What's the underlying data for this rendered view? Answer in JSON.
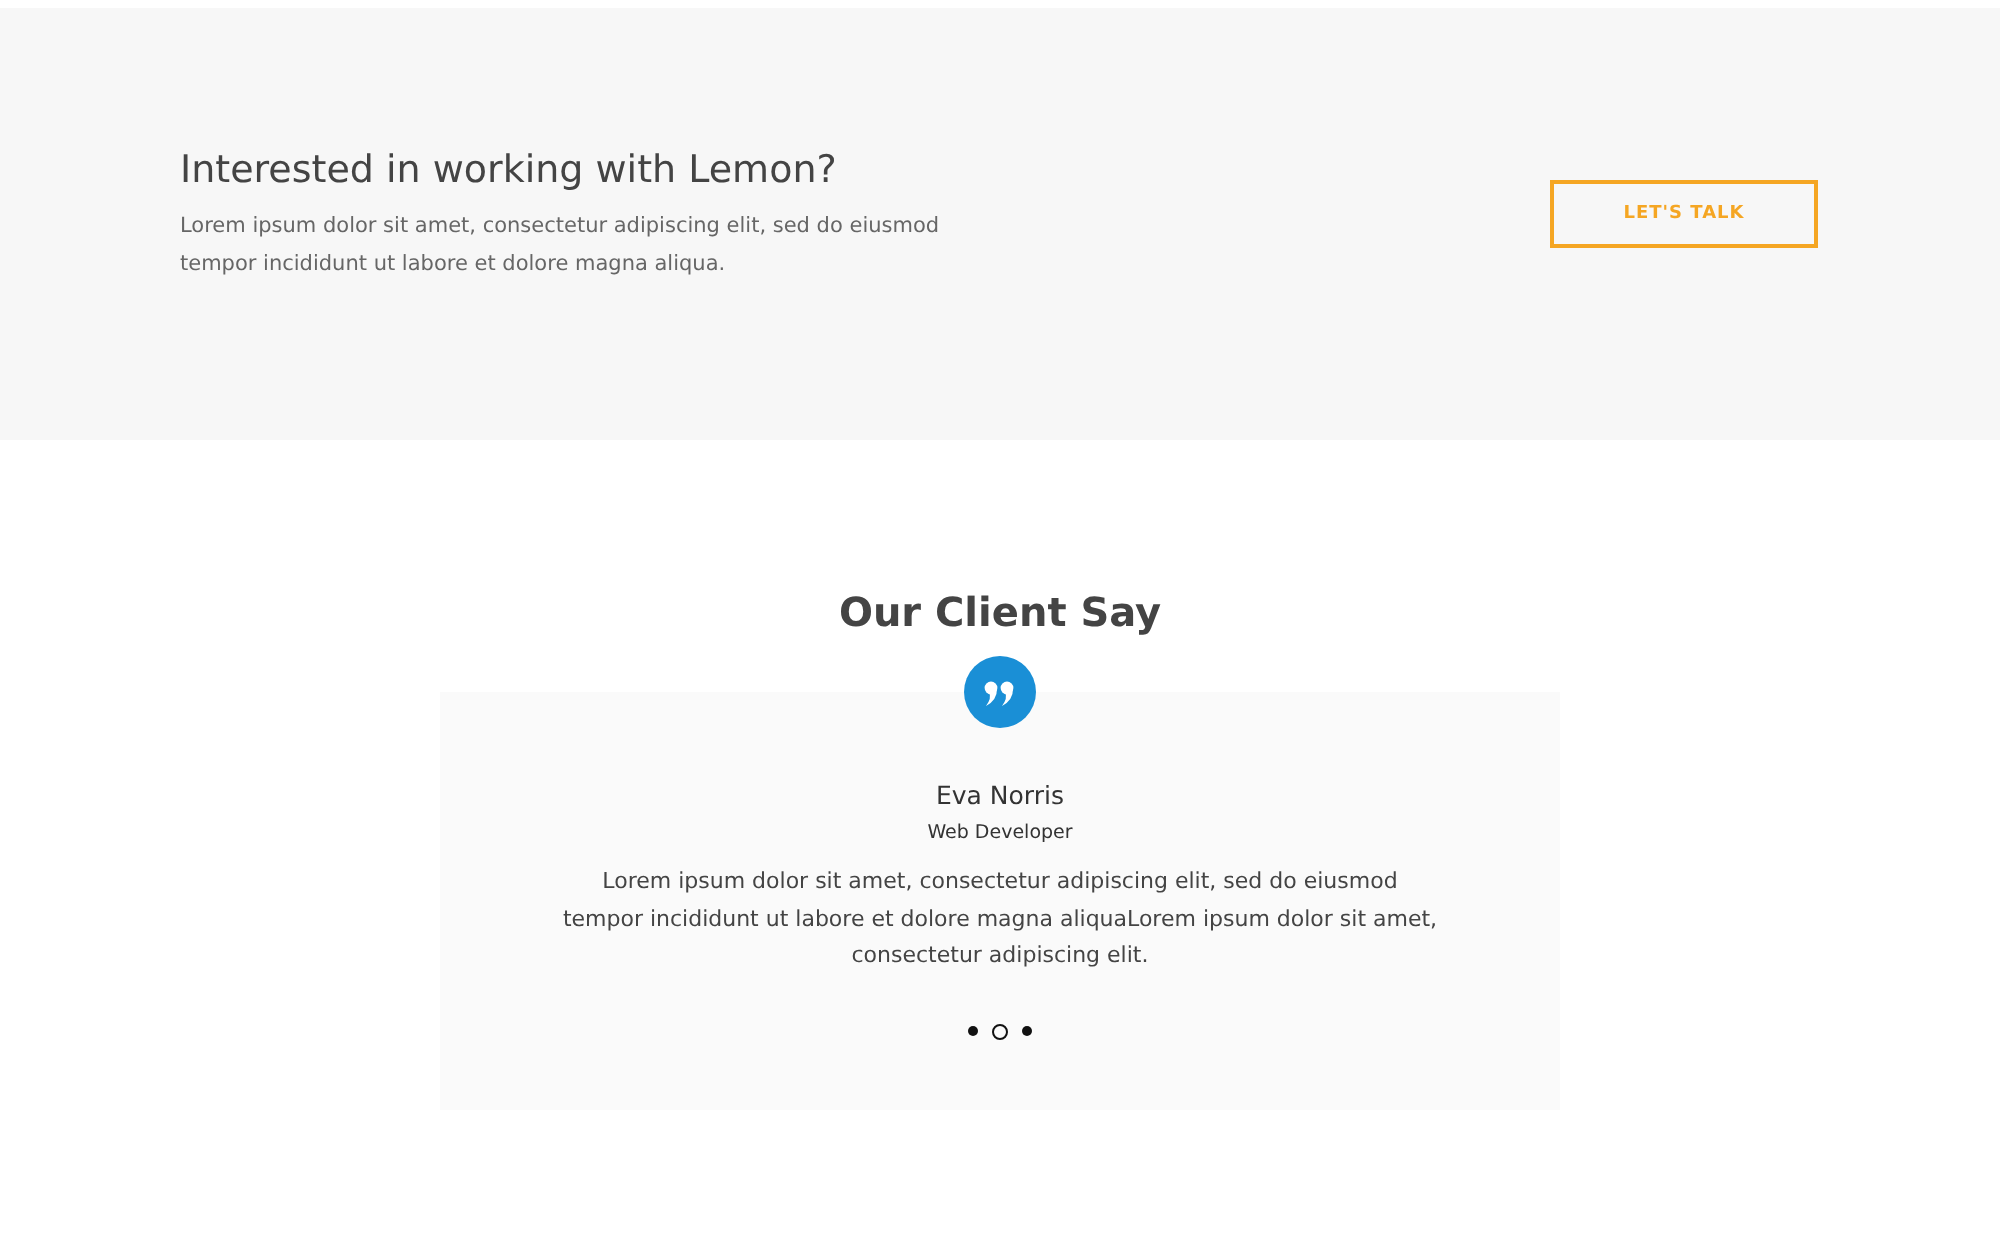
{
  "cta": {
    "title": "Interested in working with Lemon?",
    "text": "Lorem ipsum dolor sit amet, consectetur adipiscing elit, sed do eiusmod tempor incididunt ut labore et dolore magna aliqua.",
    "button": "LET'S TALK"
  },
  "testimonials": {
    "title": "Our Client Say",
    "name": "Eva Norris",
    "role": "Web Developer",
    "quote": "Lorem ipsum dolor sit amet, consectetur adipiscing elit, sed do eiusmod tempor incididunt ut labore et dolore magna aliquaLorem ipsum dolor sit amet, consectetur adipiscing elit.",
    "dots": [
      {
        "selected": false
      },
      {
        "selected": true
      },
      {
        "selected": false
      }
    ]
  }
}
